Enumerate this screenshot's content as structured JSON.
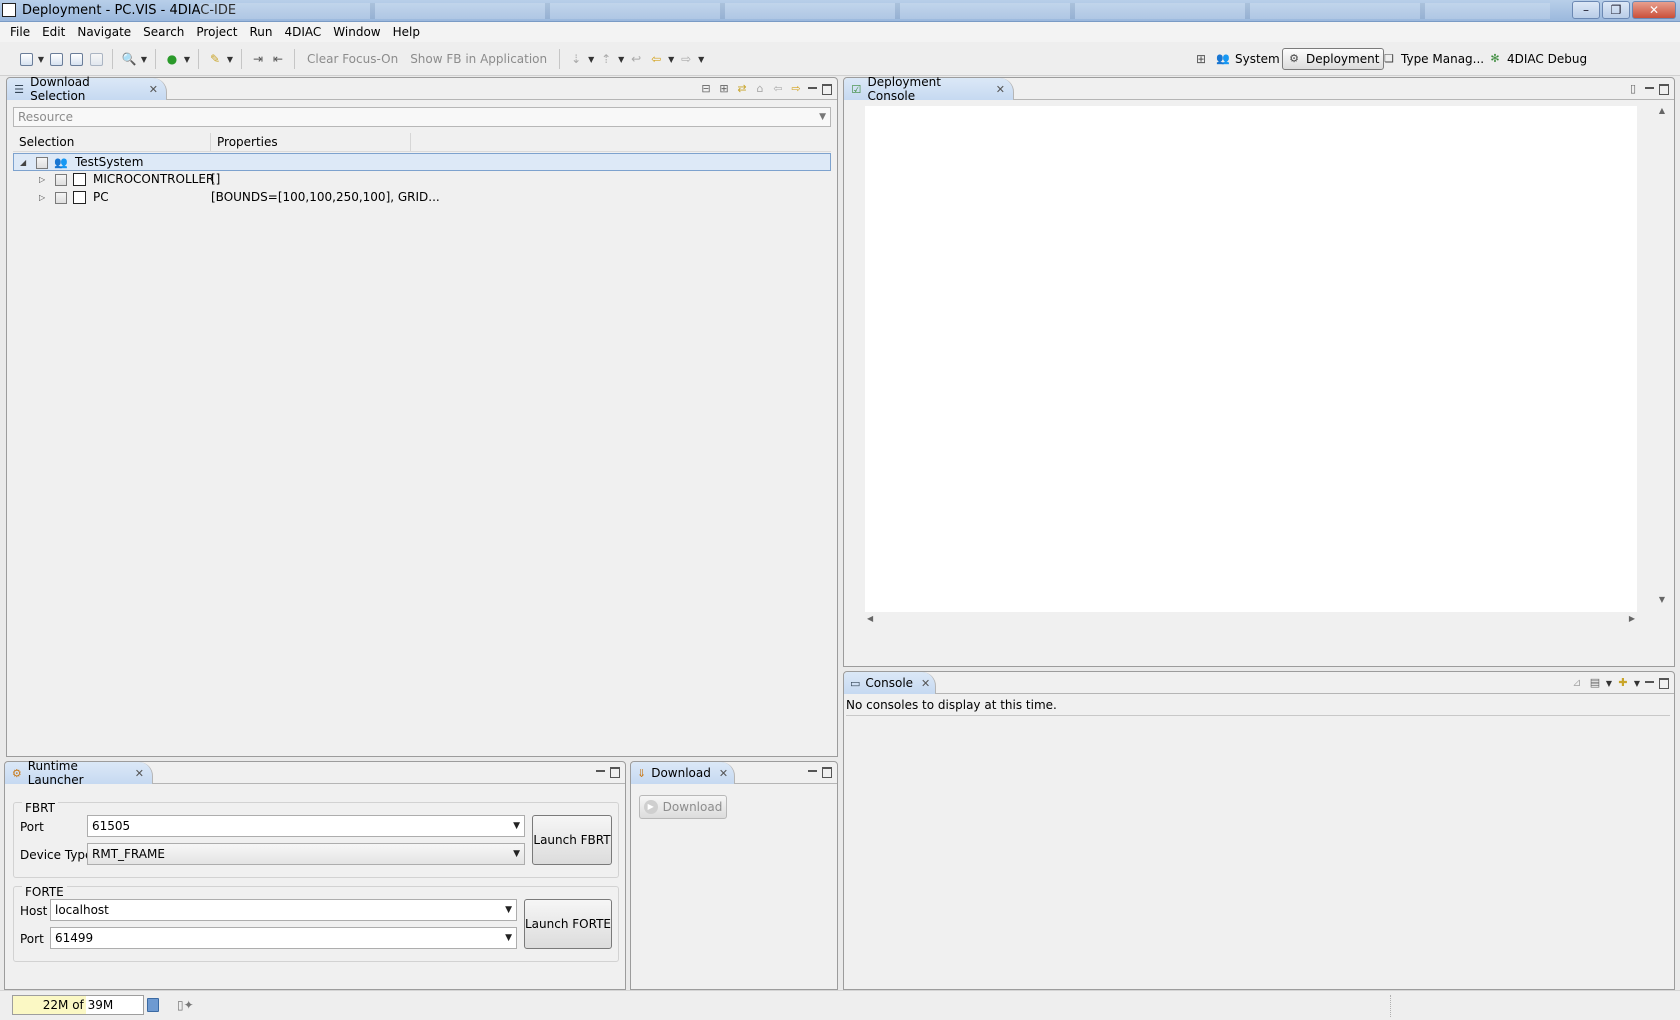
{
  "window": {
    "title": "Deployment - PC.VIS - 4DIAC-IDE"
  },
  "menu": [
    "File",
    "Edit",
    "Navigate",
    "Search",
    "Project",
    "Run",
    "4DIAC",
    "Window",
    "Help"
  ],
  "toolbar": {
    "clear_focus": "Clear Focus-On",
    "show_fb": "Show FB in Application"
  },
  "perspectives": [
    {
      "label": "System",
      "icon": "system-icon",
      "active": false
    },
    {
      "label": "Deployment",
      "icon": "deployment-icon",
      "active": true
    },
    {
      "label": "Type Manag...",
      "icon": "type-manager-icon",
      "active": false
    },
    {
      "label": "4DIAC Debug",
      "icon": "debug-icon",
      "active": false
    }
  ],
  "download_selection": {
    "tab": "Download Selection",
    "resource_placeholder": "Resource",
    "columns": [
      "Selection",
      "Properties"
    ],
    "tree": [
      {
        "label": "TestSystem",
        "properties": "",
        "level": 0,
        "expanded": true
      },
      {
        "label": "MICROCONTROLLER",
        "properties": "[]",
        "level": 1,
        "expanded": false
      },
      {
        "label": "PC",
        "properties": "[BOUNDS=[100,100,250,100], GRID...",
        "level": 1,
        "expanded": false
      }
    ]
  },
  "deployment_console": {
    "tab": "Deployment Console"
  },
  "console": {
    "tab": "Console",
    "message": "No consoles to display at this time."
  },
  "runtime_launcher": {
    "tab": "Runtime Launcher",
    "fbrt": {
      "group": "FBRT",
      "port_label": "Port",
      "port_value": "61505",
      "device_type_label": "Device Type",
      "device_type_value": "RMT_FRAME",
      "launch_label": "Launch FBRT"
    },
    "forte": {
      "group": "FORTE",
      "host_label": "Host",
      "host_value": "localhost",
      "port_label": "Port",
      "port_value": "61499",
      "launch_label": "Launch FORTE"
    }
  },
  "download": {
    "tab": "Download",
    "button": "Download"
  },
  "status": {
    "heap": "22M of 39M",
    "heap_used_fraction": 0.56
  },
  "colors": {
    "title_bar": "#9bb8dd",
    "active_tab": "#c6d9f1",
    "selection": "#dde9f7"
  }
}
